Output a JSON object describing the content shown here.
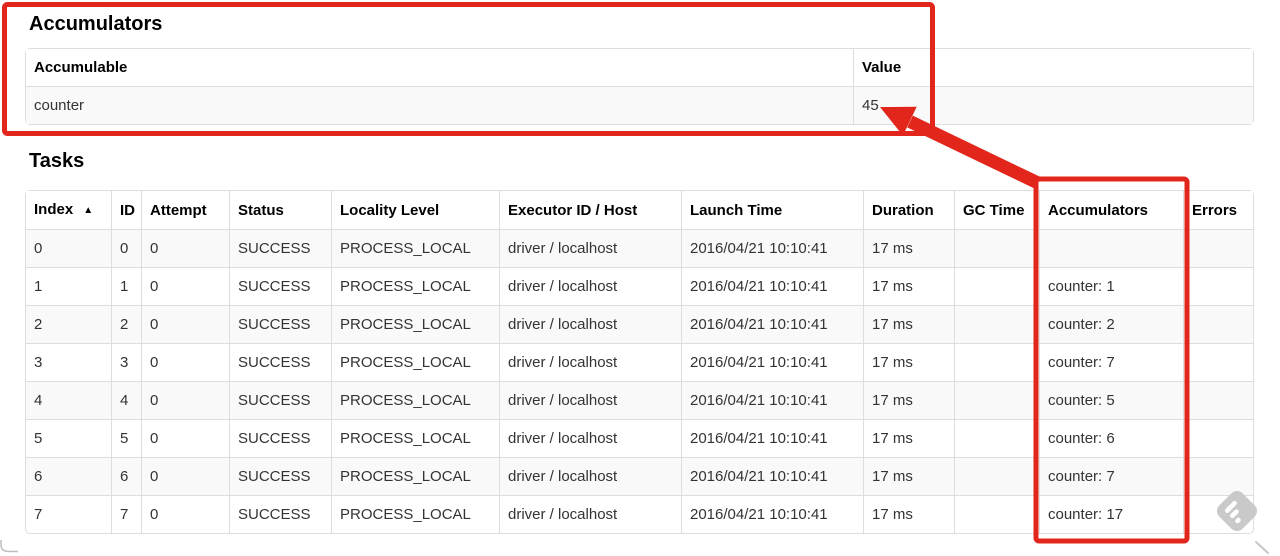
{
  "annotation_color": "#e3261b",
  "watermark_color": "#c9c9c9",
  "accumulators": {
    "heading": "Accumulators",
    "headers": [
      "Accumulable",
      "Value"
    ],
    "rows": [
      {
        "name": "counter",
        "value": "45"
      }
    ]
  },
  "tasks": {
    "heading": "Tasks",
    "headers": [
      "Index",
      "ID",
      "Attempt",
      "Status",
      "Locality Level",
      "Executor ID / Host",
      "Launch Time",
      "Duration",
      "GC Time",
      "Accumulators",
      "Errors"
    ],
    "sort": {
      "column": "Index",
      "direction_icon": "▲"
    },
    "rows": [
      {
        "index": "0",
        "id": "0",
        "attempt": "0",
        "status": "SUCCESS",
        "locality_level": "PROCESS_LOCAL",
        "executor_id_host": "driver / localhost",
        "launch_time": "2016/04/21 10:10:41",
        "duration": "17 ms",
        "gc_time": "",
        "accumulators": "",
        "errors": ""
      },
      {
        "index": "1",
        "id": "1",
        "attempt": "0",
        "status": "SUCCESS",
        "locality_level": "PROCESS_LOCAL",
        "executor_id_host": "driver / localhost",
        "launch_time": "2016/04/21 10:10:41",
        "duration": "17 ms",
        "gc_time": "",
        "accumulators": "counter: 1",
        "errors": ""
      },
      {
        "index": "2",
        "id": "2",
        "attempt": "0",
        "status": "SUCCESS",
        "locality_level": "PROCESS_LOCAL",
        "executor_id_host": "driver / localhost",
        "launch_time": "2016/04/21 10:10:41",
        "duration": "17 ms",
        "gc_time": "",
        "accumulators": "counter: 2",
        "errors": ""
      },
      {
        "index": "3",
        "id": "3",
        "attempt": "0",
        "status": "SUCCESS",
        "locality_level": "PROCESS_LOCAL",
        "executor_id_host": "driver / localhost",
        "launch_time": "2016/04/21 10:10:41",
        "duration": "17 ms",
        "gc_time": "",
        "accumulators": "counter: 7",
        "errors": ""
      },
      {
        "index": "4",
        "id": "4",
        "attempt": "0",
        "status": "SUCCESS",
        "locality_level": "PROCESS_LOCAL",
        "executor_id_host": "driver / localhost",
        "launch_time": "2016/04/21 10:10:41",
        "duration": "17 ms",
        "gc_time": "",
        "accumulators": "counter: 5",
        "errors": ""
      },
      {
        "index": "5",
        "id": "5",
        "attempt": "0",
        "status": "SUCCESS",
        "locality_level": "PROCESS_LOCAL",
        "executor_id_host": "driver / localhost",
        "launch_time": "2016/04/21 10:10:41",
        "duration": "17 ms",
        "gc_time": "",
        "accumulators": "counter: 6",
        "errors": ""
      },
      {
        "index": "6",
        "id": "6",
        "attempt": "0",
        "status": "SUCCESS",
        "locality_level": "PROCESS_LOCAL",
        "executor_id_host": "driver / localhost",
        "launch_time": "2016/04/21 10:10:41",
        "duration": "17 ms",
        "gc_time": "",
        "accumulators": "counter: 7",
        "errors": ""
      },
      {
        "index": "7",
        "id": "7",
        "attempt": "0",
        "status": "SUCCESS",
        "locality_level": "PROCESS_LOCAL",
        "executor_id_host": "driver / localhost",
        "launch_time": "2016/04/21 10:10:41",
        "duration": "17 ms",
        "gc_time": "",
        "accumulators": "counter: 17",
        "errors": ""
      }
    ]
  }
}
